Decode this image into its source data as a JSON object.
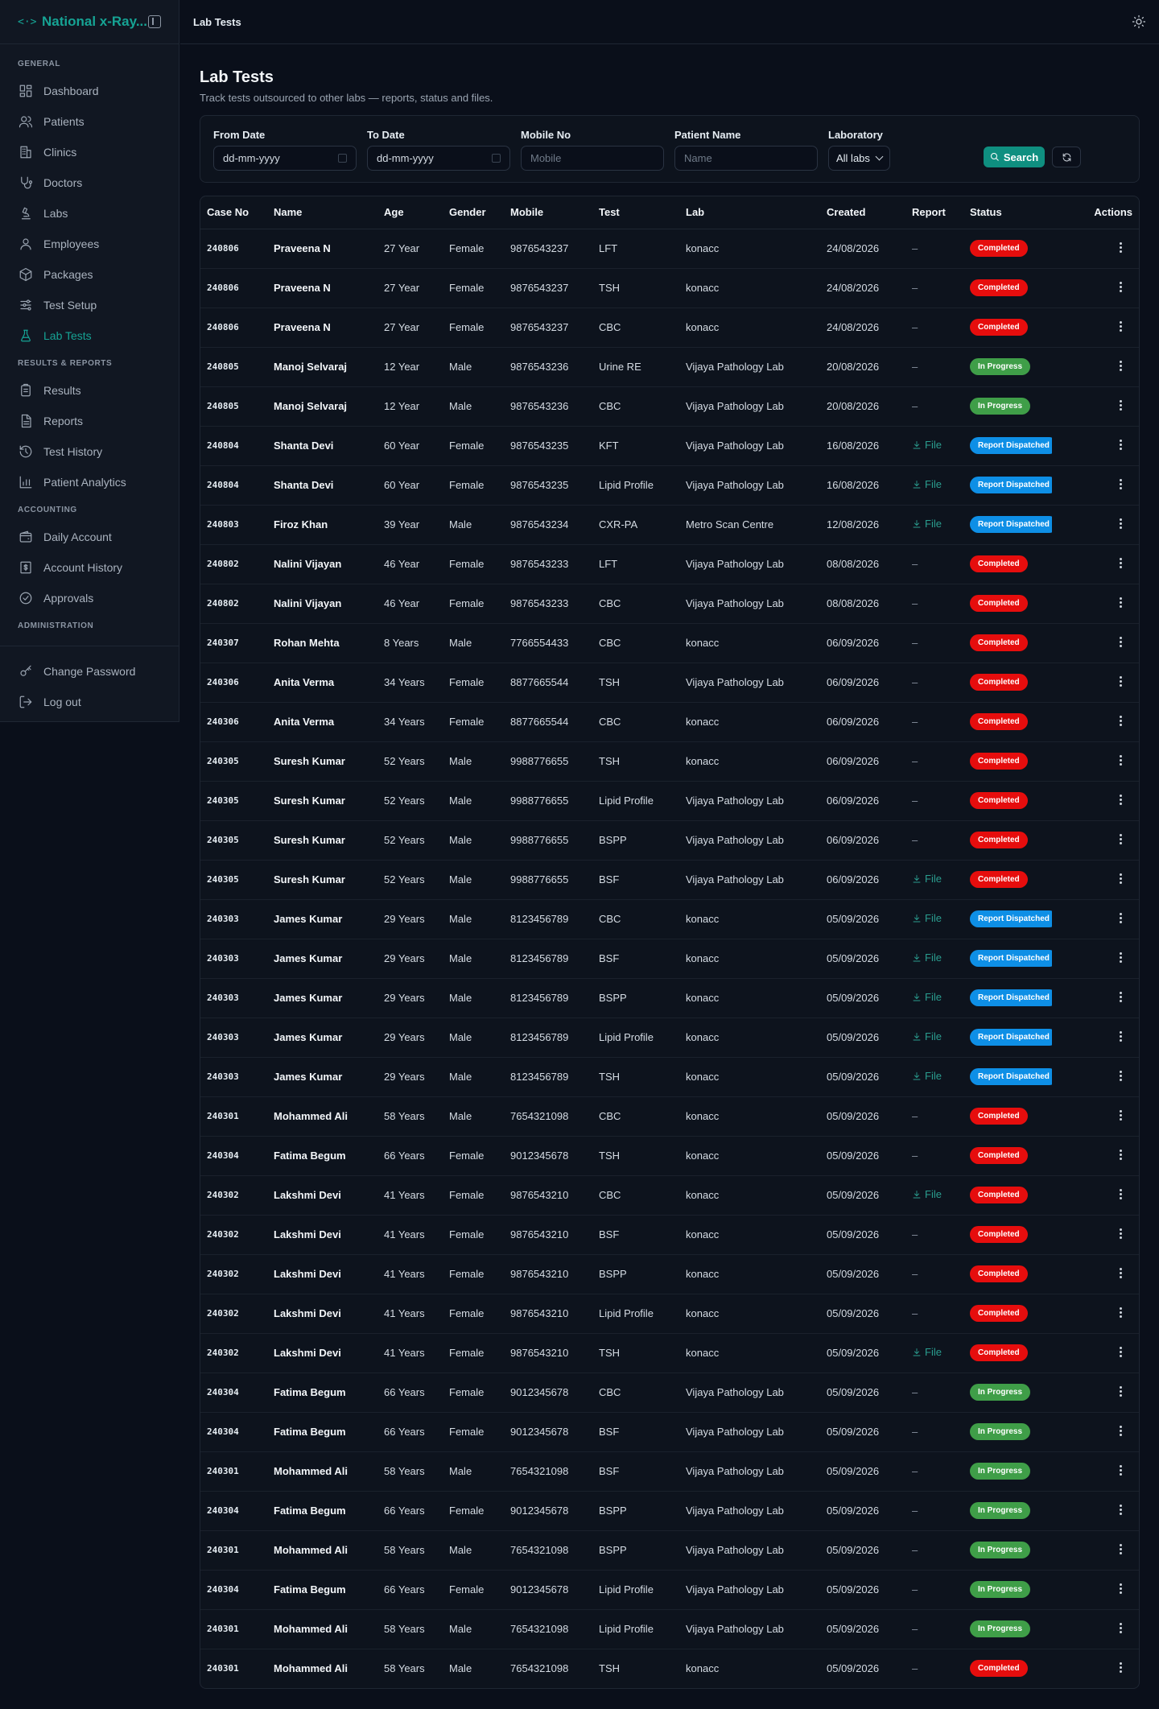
{
  "app": {
    "title": "National x-Ray...",
    "logo": "<·>"
  },
  "topbar": {
    "title": "Lab Tests"
  },
  "sidebar": {
    "sections": [
      {
        "label": "GENERAL",
        "items": [
          {
            "label": "Dashboard",
            "icon": "dashboard-icon"
          },
          {
            "label": "Patients",
            "icon": "users-icon"
          },
          {
            "label": "Clinics",
            "icon": "building-icon"
          },
          {
            "label": "Doctors",
            "icon": "stethoscope-icon"
          },
          {
            "label": "Labs",
            "icon": "microscope-icon"
          },
          {
            "label": "Employees",
            "icon": "user-icon"
          },
          {
            "label": "Packages",
            "icon": "package-icon"
          },
          {
            "label": "Test Setup",
            "icon": "sliders-icon"
          },
          {
            "label": "Lab Tests",
            "icon": "flask-icon",
            "active": true
          }
        ]
      },
      {
        "label": "RESULTS & REPORTS",
        "items": [
          {
            "label": "Results",
            "icon": "clipboard-icon"
          },
          {
            "label": "Reports",
            "icon": "file-text-icon"
          },
          {
            "label": "Test History",
            "icon": "history-icon"
          },
          {
            "label": "Patient Analytics",
            "icon": "bar-chart-icon"
          }
        ]
      },
      {
        "label": "ACCOUNTING",
        "items": [
          {
            "label": "Daily Account",
            "icon": "wallet-icon"
          },
          {
            "label": "Account History",
            "icon": "receipt-icon"
          },
          {
            "label": "Approvals",
            "icon": "check-circle-icon"
          }
        ]
      },
      {
        "label": "ADMINISTRATION",
        "items": []
      }
    ],
    "footer": [
      {
        "label": "Change Password",
        "icon": "key-icon"
      },
      {
        "label": "Log out",
        "icon": "logout-icon"
      }
    ]
  },
  "page": {
    "title": "Lab Tests",
    "subtitle": "Track tests outsourced to other labs — reports, status and files."
  },
  "filters": {
    "from_date": {
      "label": "From Date",
      "value": "dd-mm-yyyy"
    },
    "to_date": {
      "label": "To Date",
      "value": "dd-mm-yyyy"
    },
    "mobile": {
      "label": "Mobile No",
      "placeholder": "Mobile"
    },
    "patient": {
      "label": "Patient Name",
      "placeholder": "Name"
    },
    "laboratory": {
      "label": "Laboratory",
      "value": "All labs"
    },
    "search_label": "Search"
  },
  "table": {
    "columns": [
      "Case No",
      "Name",
      "Age",
      "Gender",
      "Mobile",
      "Test",
      "Lab",
      "Created",
      "Report",
      "Status",
      "Actions"
    ],
    "file_label": "File",
    "empty_report": "–",
    "rows": [
      {
        "case": "240806",
        "name": "Praveena N",
        "age": "27 Year",
        "gender": "Female",
        "mobile": "9876543237",
        "test": "LFT",
        "lab": "konacc",
        "created": "24/08/2026",
        "file": false,
        "status": "Completed"
      },
      {
        "case": "240806",
        "name": "Praveena N",
        "age": "27 Year",
        "gender": "Female",
        "mobile": "9876543237",
        "test": "TSH",
        "lab": "konacc",
        "created": "24/08/2026",
        "file": false,
        "status": "Completed"
      },
      {
        "case": "240806",
        "name": "Praveena N",
        "age": "27 Year",
        "gender": "Female",
        "mobile": "9876543237",
        "test": "CBC",
        "lab": "konacc",
        "created": "24/08/2026",
        "file": false,
        "status": "Completed"
      },
      {
        "case": "240805",
        "name": "Manoj Selvaraj",
        "age": "12 Year",
        "gender": "Male",
        "mobile": "9876543236",
        "test": "Urine RE",
        "lab": "Vijaya Pathology Lab",
        "created": "20/08/2026",
        "file": false,
        "status": "In Progress"
      },
      {
        "case": "240805",
        "name": "Manoj Selvaraj",
        "age": "12 Year",
        "gender": "Male",
        "mobile": "9876543236",
        "test": "CBC",
        "lab": "Vijaya Pathology Lab",
        "created": "20/08/2026",
        "file": false,
        "status": "In Progress"
      },
      {
        "case": "240804",
        "name": "Shanta Devi",
        "age": "60 Year",
        "gender": "Female",
        "mobile": "9876543235",
        "test": "KFT",
        "lab": "Vijaya Pathology Lab",
        "created": "16/08/2026",
        "file": true,
        "status": "Report Dispatched"
      },
      {
        "case": "240804",
        "name": "Shanta Devi",
        "age": "60 Year",
        "gender": "Female",
        "mobile": "9876543235",
        "test": "Lipid Profile",
        "lab": "Vijaya Pathology Lab",
        "created": "16/08/2026",
        "file": true,
        "status": "Report Dispatched"
      },
      {
        "case": "240803",
        "name": "Firoz Khan",
        "age": "39 Year",
        "gender": "Male",
        "mobile": "9876543234",
        "test": "CXR-PA",
        "lab": "Metro Scan Centre",
        "created": "12/08/2026",
        "file": true,
        "status": "Report Dispatched"
      },
      {
        "case": "240802",
        "name": "Nalini Vijayan",
        "age": "46 Year",
        "gender": "Female",
        "mobile": "9876543233",
        "test": "LFT",
        "lab": "Vijaya Pathology Lab",
        "created": "08/08/2026",
        "file": false,
        "status": "Completed"
      },
      {
        "case": "240802",
        "name": "Nalini Vijayan",
        "age": "46 Year",
        "gender": "Female",
        "mobile": "9876543233",
        "test": "CBC",
        "lab": "Vijaya Pathology Lab",
        "created": "08/08/2026",
        "file": false,
        "status": "Completed"
      },
      {
        "case": "240307",
        "name": "Rohan Mehta",
        "age": "8 Years",
        "gender": "Male",
        "mobile": "7766554433",
        "test": "CBC",
        "lab": "konacc",
        "created": "06/09/2026",
        "file": false,
        "status": "Completed"
      },
      {
        "case": "240306",
        "name": "Anita Verma",
        "age": "34 Years",
        "gender": "Female",
        "mobile": "8877665544",
        "test": "TSH",
        "lab": "Vijaya Pathology Lab",
        "created": "06/09/2026",
        "file": false,
        "status": "Completed"
      },
      {
        "case": "240306",
        "name": "Anita Verma",
        "age": "34 Years",
        "gender": "Female",
        "mobile": "8877665544",
        "test": "CBC",
        "lab": "konacc",
        "created": "06/09/2026",
        "file": false,
        "status": "Completed"
      },
      {
        "case": "240305",
        "name": "Suresh Kumar",
        "age": "52 Years",
        "gender": "Male",
        "mobile": "9988776655",
        "test": "TSH",
        "lab": "konacc",
        "created": "06/09/2026",
        "file": false,
        "status": "Completed"
      },
      {
        "case": "240305",
        "name": "Suresh Kumar",
        "age": "52 Years",
        "gender": "Male",
        "mobile": "9988776655",
        "test": "Lipid Profile",
        "lab": "Vijaya Pathology Lab",
        "created": "06/09/2026",
        "file": false,
        "status": "Completed"
      },
      {
        "case": "240305",
        "name": "Suresh Kumar",
        "age": "52 Years",
        "gender": "Male",
        "mobile": "9988776655",
        "test": "BSPP",
        "lab": "Vijaya Pathology Lab",
        "created": "06/09/2026",
        "file": false,
        "status": "Completed"
      },
      {
        "case": "240305",
        "name": "Suresh Kumar",
        "age": "52 Years",
        "gender": "Male",
        "mobile": "9988776655",
        "test": "BSF",
        "lab": "Vijaya Pathology Lab",
        "created": "06/09/2026",
        "file": true,
        "status": "Completed"
      },
      {
        "case": "240303",
        "name": "James Kumar",
        "age": "29 Years",
        "gender": "Male",
        "mobile": "8123456789",
        "test": "CBC",
        "lab": "konacc",
        "created": "05/09/2026",
        "file": true,
        "status": "Report Dispatched"
      },
      {
        "case": "240303",
        "name": "James Kumar",
        "age": "29 Years",
        "gender": "Male",
        "mobile": "8123456789",
        "test": "BSF",
        "lab": "konacc",
        "created": "05/09/2026",
        "file": true,
        "status": "Report Dispatched"
      },
      {
        "case": "240303",
        "name": "James Kumar",
        "age": "29 Years",
        "gender": "Male",
        "mobile": "8123456789",
        "test": "BSPP",
        "lab": "konacc",
        "created": "05/09/2026",
        "file": true,
        "status": "Report Dispatched"
      },
      {
        "case": "240303",
        "name": "James Kumar",
        "age": "29 Years",
        "gender": "Male",
        "mobile": "8123456789",
        "test": "Lipid Profile",
        "lab": "konacc",
        "created": "05/09/2026",
        "file": true,
        "status": "Report Dispatched"
      },
      {
        "case": "240303",
        "name": "James Kumar",
        "age": "29 Years",
        "gender": "Male",
        "mobile": "8123456789",
        "test": "TSH",
        "lab": "konacc",
        "created": "05/09/2026",
        "file": true,
        "status": "Report Dispatched"
      },
      {
        "case": "240301",
        "name": "Mohammed Ali",
        "age": "58 Years",
        "gender": "Male",
        "mobile": "7654321098",
        "test": "CBC",
        "lab": "konacc",
        "created": "05/09/2026",
        "file": false,
        "status": "Completed"
      },
      {
        "case": "240304",
        "name": "Fatima Begum",
        "age": "66 Years",
        "gender": "Female",
        "mobile": "9012345678",
        "test": "TSH",
        "lab": "konacc",
        "created": "05/09/2026",
        "file": false,
        "status": "Completed"
      },
      {
        "case": "240302",
        "name": "Lakshmi Devi",
        "age": "41 Years",
        "gender": "Female",
        "mobile": "9876543210",
        "test": "CBC",
        "lab": "konacc",
        "created": "05/09/2026",
        "file": true,
        "status": "Completed"
      },
      {
        "case": "240302",
        "name": "Lakshmi Devi",
        "age": "41 Years",
        "gender": "Female",
        "mobile": "9876543210",
        "test": "BSF",
        "lab": "konacc",
        "created": "05/09/2026",
        "file": false,
        "status": "Completed"
      },
      {
        "case": "240302",
        "name": "Lakshmi Devi",
        "age": "41 Years",
        "gender": "Female",
        "mobile": "9876543210",
        "test": "BSPP",
        "lab": "konacc",
        "created": "05/09/2026",
        "file": false,
        "status": "Completed"
      },
      {
        "case": "240302",
        "name": "Lakshmi Devi",
        "age": "41 Years",
        "gender": "Female",
        "mobile": "9876543210",
        "test": "Lipid Profile",
        "lab": "konacc",
        "created": "05/09/2026",
        "file": false,
        "status": "Completed"
      },
      {
        "case": "240302",
        "name": "Lakshmi Devi",
        "age": "41 Years",
        "gender": "Female",
        "mobile": "9876543210",
        "test": "TSH",
        "lab": "konacc",
        "created": "05/09/2026",
        "file": true,
        "status": "Completed"
      },
      {
        "case": "240304",
        "name": "Fatima Begum",
        "age": "66 Years",
        "gender": "Female",
        "mobile": "9012345678",
        "test": "CBC",
        "lab": "Vijaya Pathology Lab",
        "created": "05/09/2026",
        "file": false,
        "status": "In Progress"
      },
      {
        "case": "240304",
        "name": "Fatima Begum",
        "age": "66 Years",
        "gender": "Female",
        "mobile": "9012345678",
        "test": "BSF",
        "lab": "Vijaya Pathology Lab",
        "created": "05/09/2026",
        "file": false,
        "status": "In Progress"
      },
      {
        "case": "240301",
        "name": "Mohammed Ali",
        "age": "58 Years",
        "gender": "Male",
        "mobile": "7654321098",
        "test": "BSF",
        "lab": "Vijaya Pathology Lab",
        "created": "05/09/2026",
        "file": false,
        "status": "In Progress"
      },
      {
        "case": "240304",
        "name": "Fatima Begum",
        "age": "66 Years",
        "gender": "Female",
        "mobile": "9012345678",
        "test": "BSPP",
        "lab": "Vijaya Pathology Lab",
        "created": "05/09/2026",
        "file": false,
        "status": "In Progress"
      },
      {
        "case": "240301",
        "name": "Mohammed Ali",
        "age": "58 Years",
        "gender": "Male",
        "mobile": "7654321098",
        "test": "BSPP",
        "lab": "Vijaya Pathology Lab",
        "created": "05/09/2026",
        "file": false,
        "status": "In Progress"
      },
      {
        "case": "240304",
        "name": "Fatima Begum",
        "age": "66 Years",
        "gender": "Female",
        "mobile": "9012345678",
        "test": "Lipid Profile",
        "lab": "Vijaya Pathology Lab",
        "created": "05/09/2026",
        "file": false,
        "status": "In Progress"
      },
      {
        "case": "240301",
        "name": "Mohammed Ali",
        "age": "58 Years",
        "gender": "Male",
        "mobile": "7654321098",
        "test": "Lipid Profile",
        "lab": "Vijaya Pathology Lab",
        "created": "05/09/2026",
        "file": false,
        "status": "In Progress"
      },
      {
        "case": "240301",
        "name": "Mohammed Ali",
        "age": "58 Years",
        "gender": "Male",
        "mobile": "7654321098",
        "test": "TSH",
        "lab": "konacc",
        "created": "05/09/2026",
        "file": false,
        "status": "Completed"
      }
    ]
  },
  "colors": {
    "accent": "#16a394",
    "completed": "#e60d0d",
    "in_progress": "#3f9e48",
    "dispatched": "#0e8fe6",
    "background": "#0a0f1a"
  }
}
